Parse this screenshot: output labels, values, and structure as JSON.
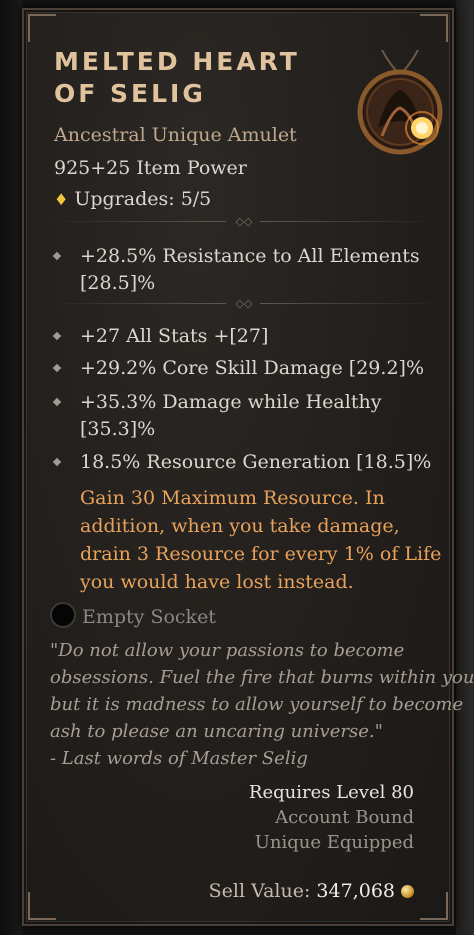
{
  "item": {
    "name_line1": "Melted Heart",
    "name_line2": "of Selig",
    "rarity_type": "Ancestral Unique Amulet",
    "item_power": "925+25 Item Power",
    "upgrades": "Upgrades: 5/5"
  },
  "affixes": {
    "implicit": [
      "+28.5% Resistance to All Elements",
      "[28.5]%"
    ],
    "stats": [
      [
        "+27 All Stats +[27]"
      ],
      [
        "+29.2% Core Skill Damage [29.2]%"
      ],
      [
        "+35.3% Damage while Healthy",
        "[35.3]%"
      ],
      [
        "18.5% Resource Generation [18.5]%"
      ]
    ],
    "unique_power": [
      "Gain 30 Maximum Resource. In",
      "addition, when you take damage,",
      "drain 3 Resource for every 1% of Life",
      "you would have lost instead."
    ]
  },
  "socket": {
    "label": "Empty Socket"
  },
  "flavor": [
    "\"Do not allow your passions to become",
    "obsessions. Fuel the fire that burns within you,",
    "but it is madness to allow yourself to become",
    "ash to please an uncaring universe.\"",
    "- Last words of Master Selig"
  ],
  "requirements": {
    "level": "Requires Level 80",
    "bound": "Account Bound",
    "unique": "Unique Equipped"
  },
  "sell": {
    "label": "Sell Value:",
    "value": "347,068"
  },
  "icons": {
    "upgrade": "diamond-upgrade-icon",
    "bullet": "diamond-bullet-icon",
    "socket": "empty-socket-icon",
    "gold": "gold-coin-icon",
    "item": "amulet-icon"
  },
  "colors": {
    "title": "#e0c39c",
    "unique_power": "#e8a25a",
    "upgrade_icon": "#f3c63a",
    "text": "#dcd7d0",
    "muted": "#9b948d"
  }
}
